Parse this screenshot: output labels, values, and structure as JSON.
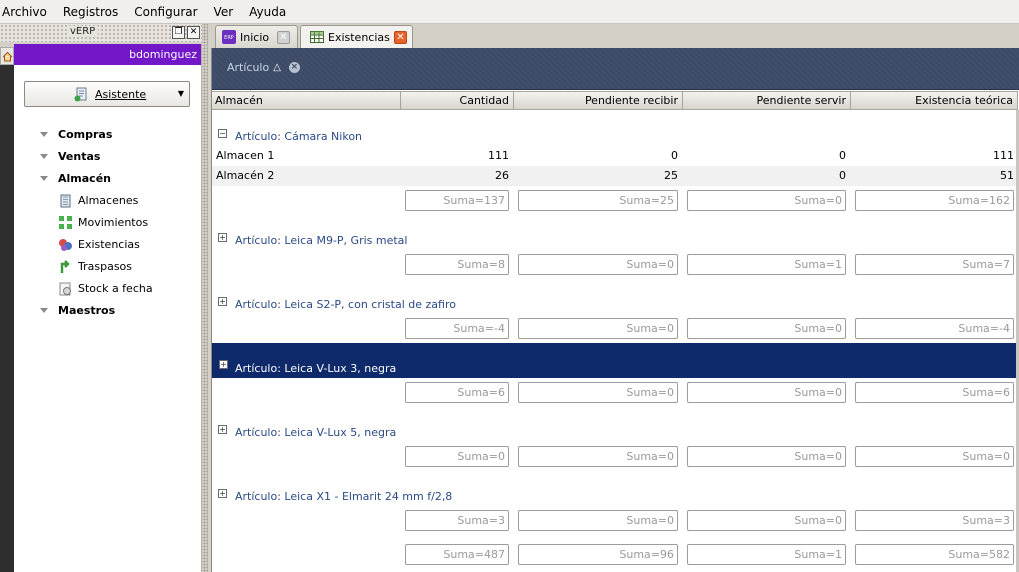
{
  "menubar": {
    "items": [
      "Archivo",
      "Registros",
      "Configurar",
      "Ver",
      "Ayuda"
    ]
  },
  "left_panel": {
    "title": "vERP",
    "user": "bdominguez",
    "assistant_button": "Asistente",
    "nav": {
      "compras": "Compras",
      "ventas": "Ventas",
      "almacen": "Almacén",
      "almacen_items": [
        "Almacenes",
        "Movimientos",
        "Existencias",
        "Traspasos",
        "Stock a fecha"
      ],
      "maestros": "Maestros"
    }
  },
  "tabs": {
    "inicio": "Inicio",
    "existencias": "Existencias"
  },
  "grid": {
    "group_by_label": "Artículo",
    "columns": [
      "Almacén",
      "Cantidad",
      "Pendiente recibir",
      "Pendiente servir",
      "Existencia teórica"
    ],
    "groups": [
      {
        "title": "Artículo: Cámara Nikon",
        "expanded": true,
        "rows": [
          [
            "Almacen 1",
            "111",
            "0",
            "0",
            "111"
          ],
          [
            "Almacén 2",
            "26",
            "25",
            "0",
            "51"
          ]
        ],
        "sums": [
          "Suma=137",
          "Suma=25",
          "Suma=0",
          "Suma=162"
        ]
      },
      {
        "title": "Artículo: Leica M9-P, Gris metal",
        "expanded": false,
        "rows": [],
        "sums": [
          "Suma=8",
          "Suma=0",
          "Suma=1",
          "Suma=7"
        ]
      },
      {
        "title": "Artículo: Leica S2-P, con cristal de zafiro",
        "expanded": false,
        "rows": [],
        "sums": [
          "Suma=-4",
          "Suma=0",
          "Suma=0",
          "Suma=-4"
        ]
      },
      {
        "title": "Artículo: Leica V-Lux 3, negra",
        "expanded": false,
        "selected": true,
        "rows": [],
        "sums": [
          "Suma=6",
          "Suma=0",
          "Suma=0",
          "Suma=6"
        ]
      },
      {
        "title": "Artículo: Leica V-Lux 5, negra",
        "expanded": false,
        "rows": [],
        "sums": [
          "Suma=0",
          "Suma=0",
          "Suma=0",
          "Suma=0"
        ]
      },
      {
        "title": "Artículo: Leica X1 - Elmarit 24 mm f/2,8",
        "expanded": false,
        "rows": [],
        "sums": [
          "Suma=3",
          "Suma=0",
          "Suma=0",
          "Suma=3"
        ]
      }
    ],
    "grand_totals": [
      "Suma=487",
      "Suma=96",
      "Suma=1",
      "Suma=582"
    ]
  },
  "colors": {
    "user_bar": "#7117c8",
    "group_panel": "#3b4a66",
    "selection": "#0e2a6b",
    "group_title": "#2b4a86",
    "close_tab_active": "#e8622c"
  }
}
